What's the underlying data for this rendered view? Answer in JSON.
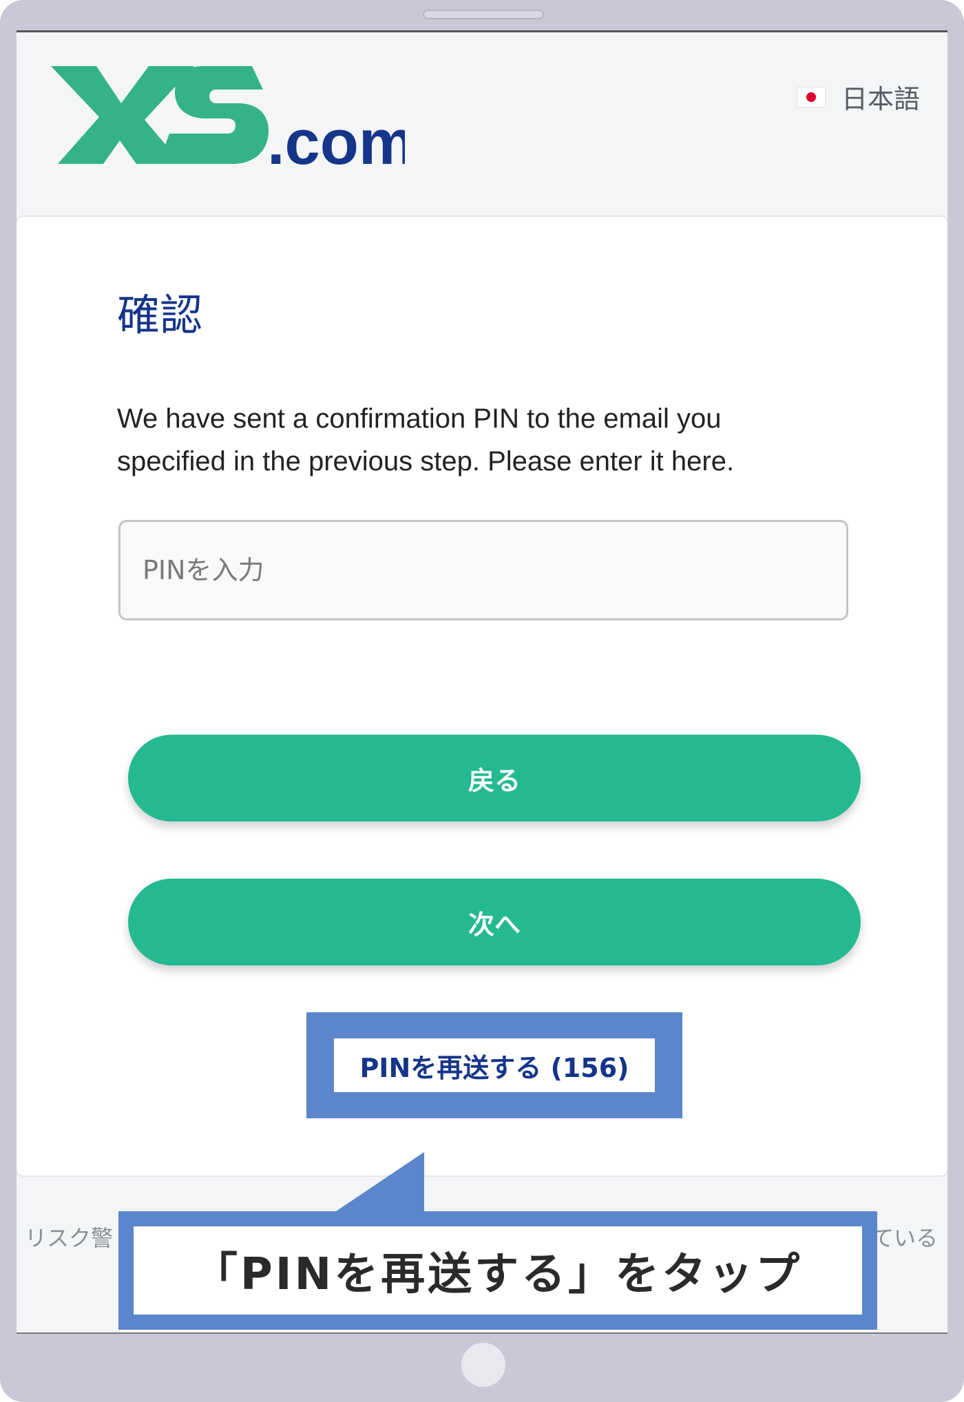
{
  "header": {
    "logo_alt": "XS.com",
    "language_label": "日本語"
  },
  "form": {
    "title": "確認",
    "description": "We have sent a confirmation PIN to the email you specified in the previous step. Please enter it here.",
    "pin_placeholder": "PINを入力",
    "pin_value": "",
    "back_label": "戻る",
    "next_label": "次へ",
    "resend_label": "PINを再送する (156)"
  },
  "footer": {
    "left_text": "リスク警",
    "right_text": "している"
  },
  "callout": {
    "text": "「PINを再送する」をタップ"
  },
  "colors": {
    "brand_green": "#24b990",
    "brand_navy": "#15358a",
    "callout_blue": "#5b86cc"
  }
}
